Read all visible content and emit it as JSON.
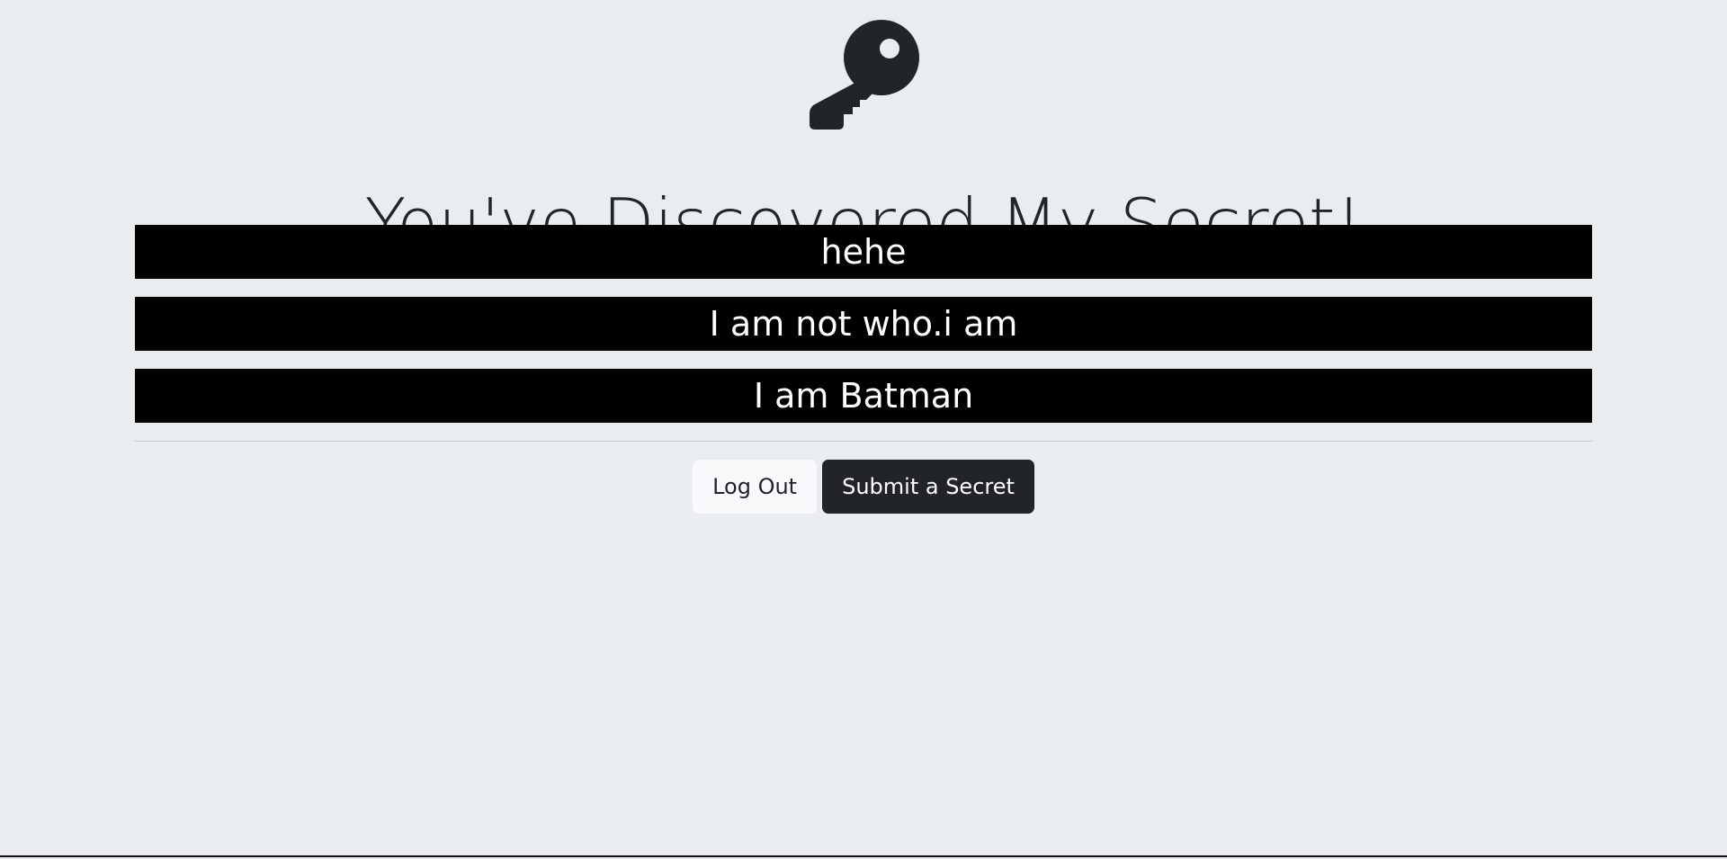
{
  "header": {
    "icon": "key-icon",
    "title": "You've Discovered My Secret!"
  },
  "secrets": [
    "hehe",
    "I am not who.i am",
    "I am Batman"
  ],
  "actions": {
    "logout_label": "Log Out",
    "submit_label": "Submit a Secret"
  },
  "colors": {
    "background": "#e9edf0",
    "secret_bar": "#000000",
    "secret_text": "#ffffff",
    "dark": "#212529",
    "light": "#f8f9fa"
  }
}
